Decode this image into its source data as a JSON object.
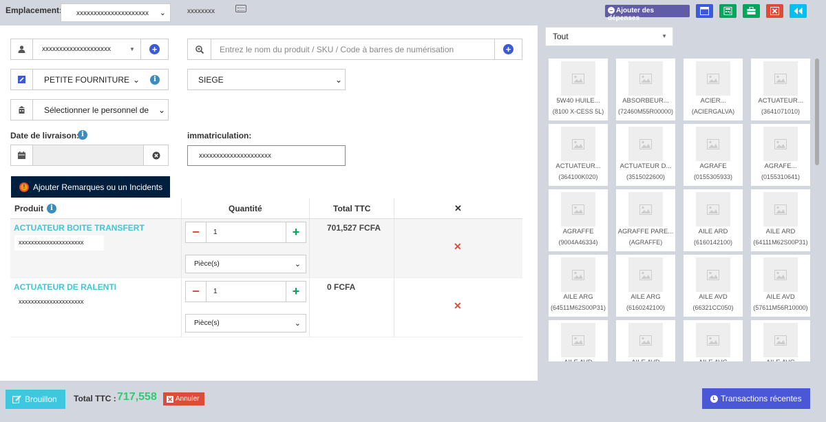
{
  "topbar": {
    "location_label": "Emplacement:",
    "location_value": "xxxxxxxxxxxxxxxxxxxxx",
    "register_text": "xxxxxxxx",
    "add_expenses_label": "Ajouter des dépenses",
    "colors": {
      "purple": "#605ca8",
      "blue": "#3c5ad6",
      "green": "#00a65a",
      "red": "#dd4b39",
      "cyan": "#00c0ef"
    }
  },
  "form": {
    "customer_value": "xxxxxxxxxxxxxxxxxxxx",
    "product_search_placeholder": "Entrez le nom du produit / SKU / Code à barres de numérisation",
    "category_value": "PETITE FOURNITURE",
    "site_value": "SIEGE",
    "staff_placeholder": "Sélectionner le personnel de",
    "delivery_date_label": "Date de livraison:",
    "registration_label": "immatriculation:",
    "registration_value": "xxxxxxxxxxxxxxxxxxxxx",
    "incident_button": "Ajouter Remarques ou un Incidents"
  },
  "table": {
    "headers": {
      "product": "Produit",
      "quantity": "Quantité",
      "total": "Total TTC",
      "remove": "✕"
    },
    "rows": [
      {
        "name": "ACTUATEUR BOITE TRANSFERT",
        "code": "xxxxxxxxxxxxxxxxxxxxx",
        "qty": "1",
        "unit": "Pièce(s)",
        "total": "701,527 FCFA"
      },
      {
        "name": "ACTUATEUR DE RALENTI",
        "code": "xxxxxxxxxxxxxxxxxxxxx",
        "qty": "1",
        "unit": "Pièce(s)",
        "total": "0 FCFA"
      }
    ]
  },
  "catalog": {
    "filter_value": "Tout",
    "items": [
      {
        "name": "5W40 HUILE...",
        "code": "(8100 X-CESS 5L)"
      },
      {
        "name": "ABSORBEUR...",
        "code": "(72460M55R00000)"
      },
      {
        "name": "ACIER...",
        "code": "(ACIERGALVA)"
      },
      {
        "name": "ACTUATEUR...",
        "code": "(3641071010)"
      },
      {
        "name": "ACTUATEUR...",
        "code": "(364100K020)"
      },
      {
        "name": "ACTUATEUR D...",
        "code": "(3515022600)"
      },
      {
        "name": "AGRAFE",
        "code": "(0155305933)"
      },
      {
        "name": "AGRAFE...",
        "code": "(0155310641)"
      },
      {
        "name": "AGRAFFE",
        "code": "(9004A46334)"
      },
      {
        "name": "AGRAFFE PARE...",
        "code": "(AGRAFFE)"
      },
      {
        "name": "AILE ARD",
        "code": "(6160142100)"
      },
      {
        "name": "AILE ARD",
        "code": "(64111M62S00P31)"
      },
      {
        "name": "AILE ARG",
        "code": "(64511M62S00P31)"
      },
      {
        "name": "AILE ARG",
        "code": "(6160242100)"
      },
      {
        "name": "AILE AVD",
        "code": "(66321CC050)"
      },
      {
        "name": "AILE AVD",
        "code": "(57611M56R10000)"
      },
      {
        "name": "AILE AVD",
        "code": ""
      },
      {
        "name": "AILE AVD",
        "code": ""
      },
      {
        "name": "AILE AVG",
        "code": ""
      },
      {
        "name": "AILE AVG",
        "code": ""
      }
    ]
  },
  "footer": {
    "draft_label": "Brouillon",
    "total_label": "Total TTC :",
    "total_value": "717,558",
    "cancel_label": "Annuler",
    "recent_label": "Transactions récentes"
  }
}
